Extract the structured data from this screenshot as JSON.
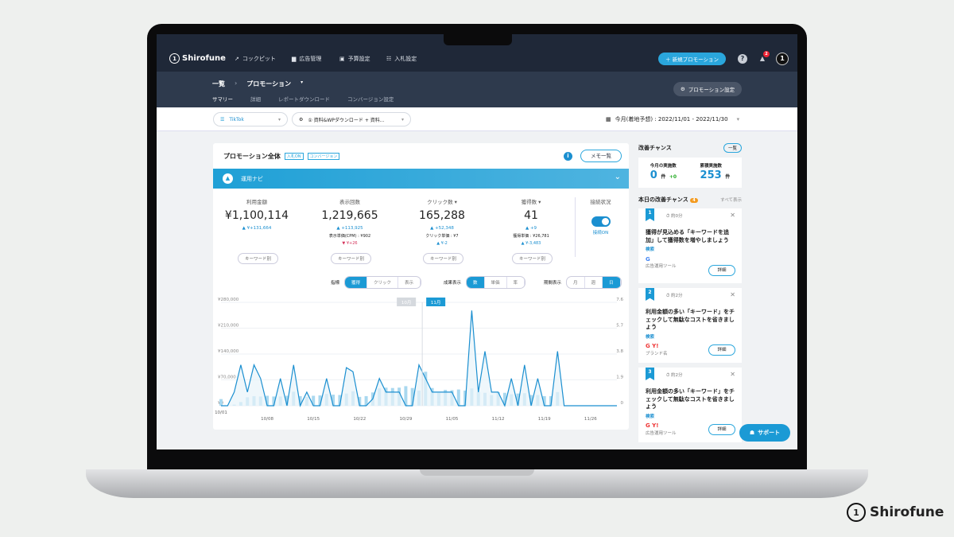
{
  "app": {
    "logo": "Shirofune"
  },
  "topnav": {
    "items": [
      {
        "icon": "trend-icon",
        "glyph": "↗",
        "label": "コックピット"
      },
      {
        "icon": "folder-icon",
        "glyph": "▆",
        "label": "広告管理"
      },
      {
        "icon": "wallet-icon",
        "glyph": "▣",
        "label": "予算設定"
      },
      {
        "icon": "sliders-icon",
        "glyph": "☷",
        "label": "入札設定"
      }
    ],
    "new_button": "＋ 新規プロモーション",
    "help": "?",
    "notification_count": "2"
  },
  "subheader": {
    "breadcrumb": [
      "一覧",
      "プロモーション"
    ],
    "tabs": [
      "サマリー",
      "詳細",
      "レポートダウンロード",
      "コンバージョン設定"
    ],
    "settings_button": "プロモーション設定"
  },
  "filters": {
    "media": "TikTok",
    "conversion": "① 資料&WPダウンロード + 資料...",
    "date": "今月(着地予想) : 2022/11/01 - 2022/11/30"
  },
  "summary": {
    "title": "プロモーション全体",
    "tags": [
      "入札ON",
      "コンバージョン"
    ],
    "memo_button": "メモ一覧",
    "navi": "運用ナビ",
    "kpis": [
      {
        "label": "利用金額",
        "value": "¥1,100,114",
        "delta": "¥+131,664",
        "sub": "",
        "sub_delta": "",
        "button": "キーワード別"
      },
      {
        "label": "表示回数",
        "value": "1,219,665",
        "delta": "+113,925",
        "sub": "表示単価(CPM) : ¥902",
        "sub_delta": "¥+26",
        "button": "キーワード別"
      },
      {
        "label": "クリック数 ▾",
        "value": "165,288",
        "delta": "+52,348",
        "sub": "クリック単価 : ¥7",
        "sub_delta": "¥-2",
        "button": "キーワード別"
      },
      {
        "label": "獲得数 ▾",
        "value": "41",
        "delta": "+9",
        "sub": "獲得単価 : ¥26,781",
        "sub_delta": "¥-3,483",
        "button": "キーワード別"
      }
    ],
    "connection": {
      "label": "接続状況",
      "status": "接続ON"
    },
    "controls": [
      {
        "label": "指標",
        "options": [
          "獲得",
          "クリック",
          "表示"
        ],
        "active": 0
      },
      {
        "label": "成果表示",
        "options": [
          "数",
          "単価",
          "率"
        ],
        "active": 0
      },
      {
        "label": "期間表示",
        "options": [
          "月",
          "週",
          "日"
        ],
        "active": 2
      }
    ]
  },
  "chance": {
    "title": "改善チャンス",
    "list_button": "一覧",
    "month_label": "今月の実施数",
    "month_value": "0",
    "month_unit": "件",
    "month_delta": "+0",
    "total_label": "累積実施数",
    "total_value": "253",
    "total_unit": "件",
    "today_title": "本日の改善チャンス",
    "today_count": "4",
    "show_all": "すべて表示",
    "cards": [
      {
        "no": "1",
        "time": "約0分",
        "text": "獲得が見込める「キーワードを追加」して獲得数を増やしましょう",
        "category": "検索",
        "logos": "G",
        "tool": "広告運用ツール",
        "button": "詳細"
      },
      {
        "no": "2",
        "time": "約2分",
        "text": "利用金額の多い「キーワード」をチェックして無駄なコストを省きましょう",
        "category": "検索",
        "logos": "G Y!",
        "tool": "ブランド名",
        "button": "詳細"
      },
      {
        "no": "3",
        "time": "約2分",
        "text": "利用金額の多い「キーワード」をチェックして無駄なコストを省きましょう",
        "category": "検索",
        "logos": "G Y!",
        "tool": "広告運用ツール",
        "button": "詳細"
      }
    ]
  },
  "support_button": "サポート",
  "brand_watermark": "Shirofune",
  "chart_data": {
    "type": "bar+line",
    "x_start": "10/01",
    "days": 61,
    "xticks": [
      "10/01",
      "10/08",
      "10/15",
      "10/22",
      "10/29",
      "11/05",
      "11/12",
      "11/19",
      "11/26"
    ],
    "yleft_ticks": [
      "¥0",
      "¥70,000",
      "¥140,000",
      "¥210,000",
      "¥280,000"
    ],
    "yleft_max": 280000,
    "yright_ticks": [
      "0",
      "1.9",
      "3.8",
      "5.7",
      "7.6"
    ],
    "yright_max": 7.6,
    "month_labels": [
      "10月",
      "11月"
    ],
    "bars_spend": [
      18000,
      0,
      3000,
      10000,
      23000,
      26000,
      25000,
      27000,
      25000,
      25000,
      27000,
      38000,
      26000,
      24000,
      27000,
      28000,
      32000,
      30000,
      29000,
      33000,
      39000,
      24000,
      26000,
      36000,
      47000,
      49000,
      48000,
      49000,
      53000,
      48000,
      41000,
      92000,
      48000,
      35000,
      43000,
      42000,
      44000,
      41000,
      47000,
      37000,
      35000,
      29000,
      37000,
      35000,
      31000,
      33000,
      34000,
      29000,
      29000,
      26000,
      26000,
      37000,
      0,
      0,
      0,
      0,
      0,
      0,
      0,
      0,
      0
    ],
    "line_conversions": [
      0,
      0,
      1,
      3,
      1,
      3,
      2,
      0,
      0,
      2,
      0,
      3,
      0,
      1,
      0,
      0,
      2,
      0,
      0,
      2.8,
      2.5,
      0,
      0,
      0.5,
      2,
      1,
      1,
      1,
      0,
      0,
      3,
      2,
      1,
      1,
      1,
      1,
      0,
      0,
      7,
      1,
      4,
      1,
      1,
      0,
      2,
      0,
      3,
      0,
      2,
      0,
      0,
      4,
      0,
      0,
      0,
      0,
      0,
      0,
      0,
      0,
      0
    ]
  }
}
